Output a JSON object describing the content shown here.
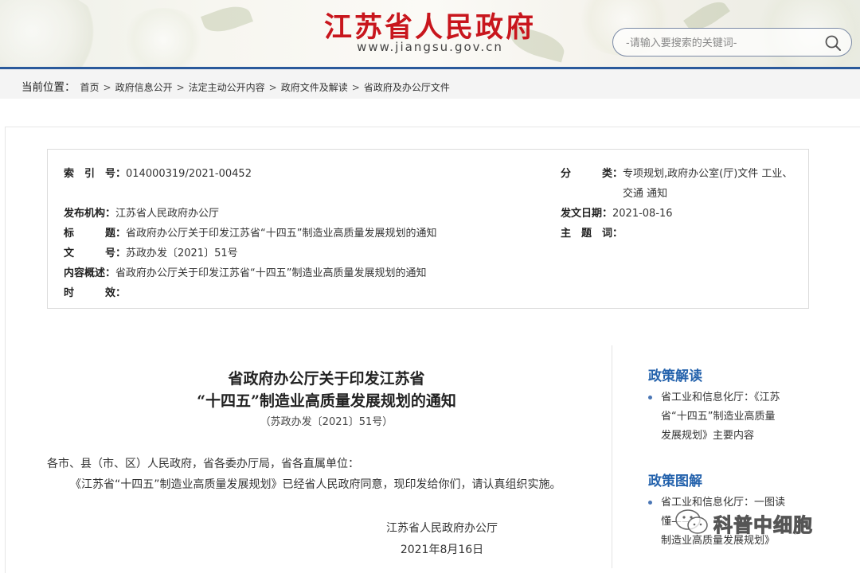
{
  "header": {
    "site_title": "江苏省人民政府",
    "site_url": "www.jiangsu.gov.cn",
    "search_placeholder": "-请输入要搜索的关键词-"
  },
  "breadcrumb": {
    "prefix": "当前位置：",
    "items": [
      "首页",
      "政府信息公开",
      "法定主动公开内容",
      "政府文件及解读",
      "省政府及办公厅文件"
    ],
    "separator": ">"
  },
  "meta": {
    "index_no": {
      "label": "索　引　号：",
      "value": "014000319/2021-00452"
    },
    "category": {
      "label": "分　　　类：",
      "value_line1": "专项规划,政府办公室(厅)文件 工业、",
      "value_line2": "交通 通知"
    },
    "publisher": {
      "label": "发布机构：",
      "value": "江苏省人民政府办公厅"
    },
    "publish_date": {
      "label": "发文日期：",
      "value": "2021-08-16"
    },
    "title": {
      "label": "标　　　题：",
      "value": "省政府办公厅关于印发江苏省“十四五”制造业高质量发展规划的通知"
    },
    "subject": {
      "label": "主　题　词：",
      "value": ""
    },
    "doc_no": {
      "label": "文　　　号：",
      "value": "苏政办发〔2021〕51号"
    },
    "summary": {
      "label": "内容概述：",
      "value": "省政府办公厅关于印发江苏省“十四五”制造业高质量发展规划的通知"
    },
    "validity": {
      "label": "时　　　效：",
      "value": ""
    }
  },
  "article": {
    "title_line1": "省政府办公厅关于印发江苏省",
    "title_line2": "“十四五”制造业高质量发展规划的通知",
    "doc_no": "（苏政办发〔2021〕51号）",
    "salutation": "各市、县（市、区）人民政府，省各委办厅局，省各直属单位：",
    "body": "《江苏省“十四五”制造业高质量发展规划》已经省人民政府同意，现印发给你们，请认真组织实施。",
    "signature": "江苏省人民政府办公厅",
    "date": "2021年8月16日"
  },
  "sidebar": {
    "interpretation_heading": "政策解读",
    "interpretation_items": [
      {
        "line1": "省工业和信息化厅：《江苏",
        "line2": "省“十四五”制造业高质量",
        "line3": "发展规划》主要内容"
      }
    ],
    "diagram_heading": "政策图解",
    "diagram_items": [
      {
        "line1": "省工业和信息化厅：一图读",
        "line2": "懂——",
        "line3": "制造业高质量发展规划》"
      }
    ]
  },
  "watermark": {
    "text": "科普中细胞"
  },
  "colors": {
    "brand_red": "#c8161d",
    "header_line": "#2b5a9b",
    "link_blue": "#2462ac"
  }
}
